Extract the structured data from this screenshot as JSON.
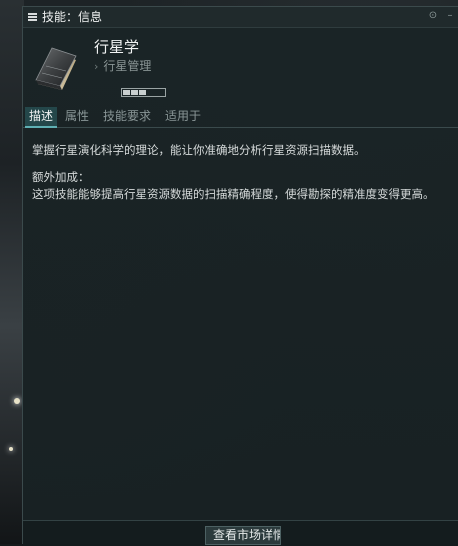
{
  "window": {
    "title": "技能：信息"
  },
  "skill": {
    "name": "行星学",
    "group": "行星管理",
    "group_chevron": "›",
    "level": 3,
    "level_max": 5
  },
  "tabs": [
    {
      "label": "描述",
      "active": true
    },
    {
      "label": "属性",
      "active": false
    },
    {
      "label": "技能要求",
      "active": false
    },
    {
      "label": "适用于",
      "active": false
    }
  ],
  "description": {
    "main": "掌握行星演化科学的理论，能让你准确地分析行星资源扫描数据。",
    "bonus_heading": "额外加成：",
    "bonus_text": "这项技能能够提高行星资源数据的扫描精确程度，使得勘探的精准度变得更高。"
  },
  "footer": {
    "market_button": "查看市场详情"
  },
  "icons": {
    "menu": "menu-icon",
    "pin": "pin-icon",
    "minimize": "minimize-icon",
    "skill": "book-icon"
  }
}
